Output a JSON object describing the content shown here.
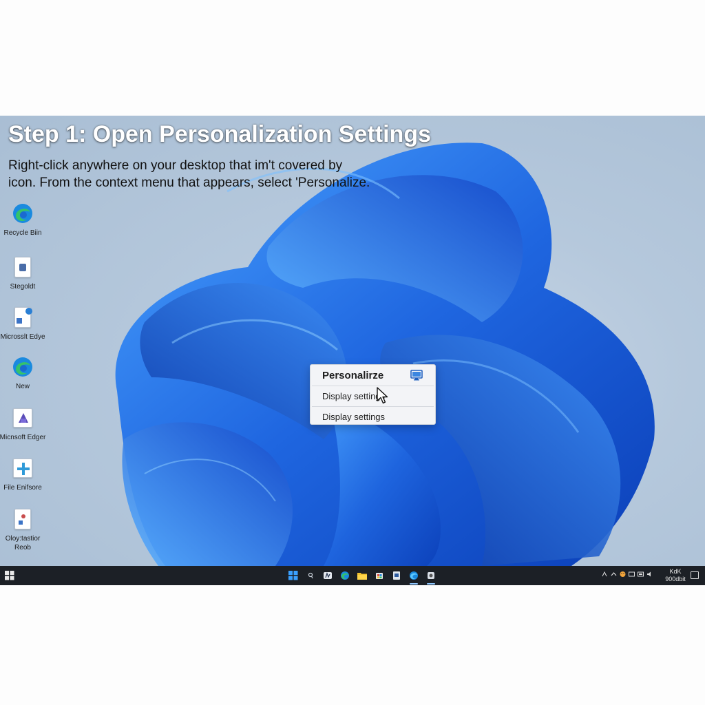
{
  "tutorial": {
    "title": "Step 1: Open Personalization Settings",
    "instruction_line1": "Right-click anywhere on your desktop that im't covered by",
    "instruction_line2": "icon. From the context menu that appears, select 'Personalize."
  },
  "desktop_icons": [
    {
      "label": "Recycle Biin",
      "icon": "edge-icon"
    },
    {
      "label": "Stegoldt",
      "icon": "file-icon"
    },
    {
      "label": "Microsslt Edye",
      "icon": "shortcut-icon"
    },
    {
      "label": "New",
      "icon": "edge-icon"
    },
    {
      "label": "Micnsoft Edger",
      "icon": "app-icon"
    },
    {
      "label": "File Enifsore",
      "icon": "plus-icon"
    },
    {
      "label": "Oloy:tastior",
      "label2": "Reob",
      "icon": "file-icon"
    }
  ],
  "context_menu": {
    "items": [
      {
        "label": "Personalirze",
        "icon": "monitor-icon"
      },
      {
        "label": "Display settings"
      },
      {
        "label": "Display settings"
      }
    ]
  },
  "taskbar": {
    "clock_line1": "KdK",
    "clock_line2": "900dbit",
    "colors": {
      "background": "#1c2026",
      "accent": "#8fc8ff"
    }
  },
  "colors": {
    "wallpaper_bloom": "#1e5fd6",
    "wallpaper_bg": "#b5c8dc"
  }
}
